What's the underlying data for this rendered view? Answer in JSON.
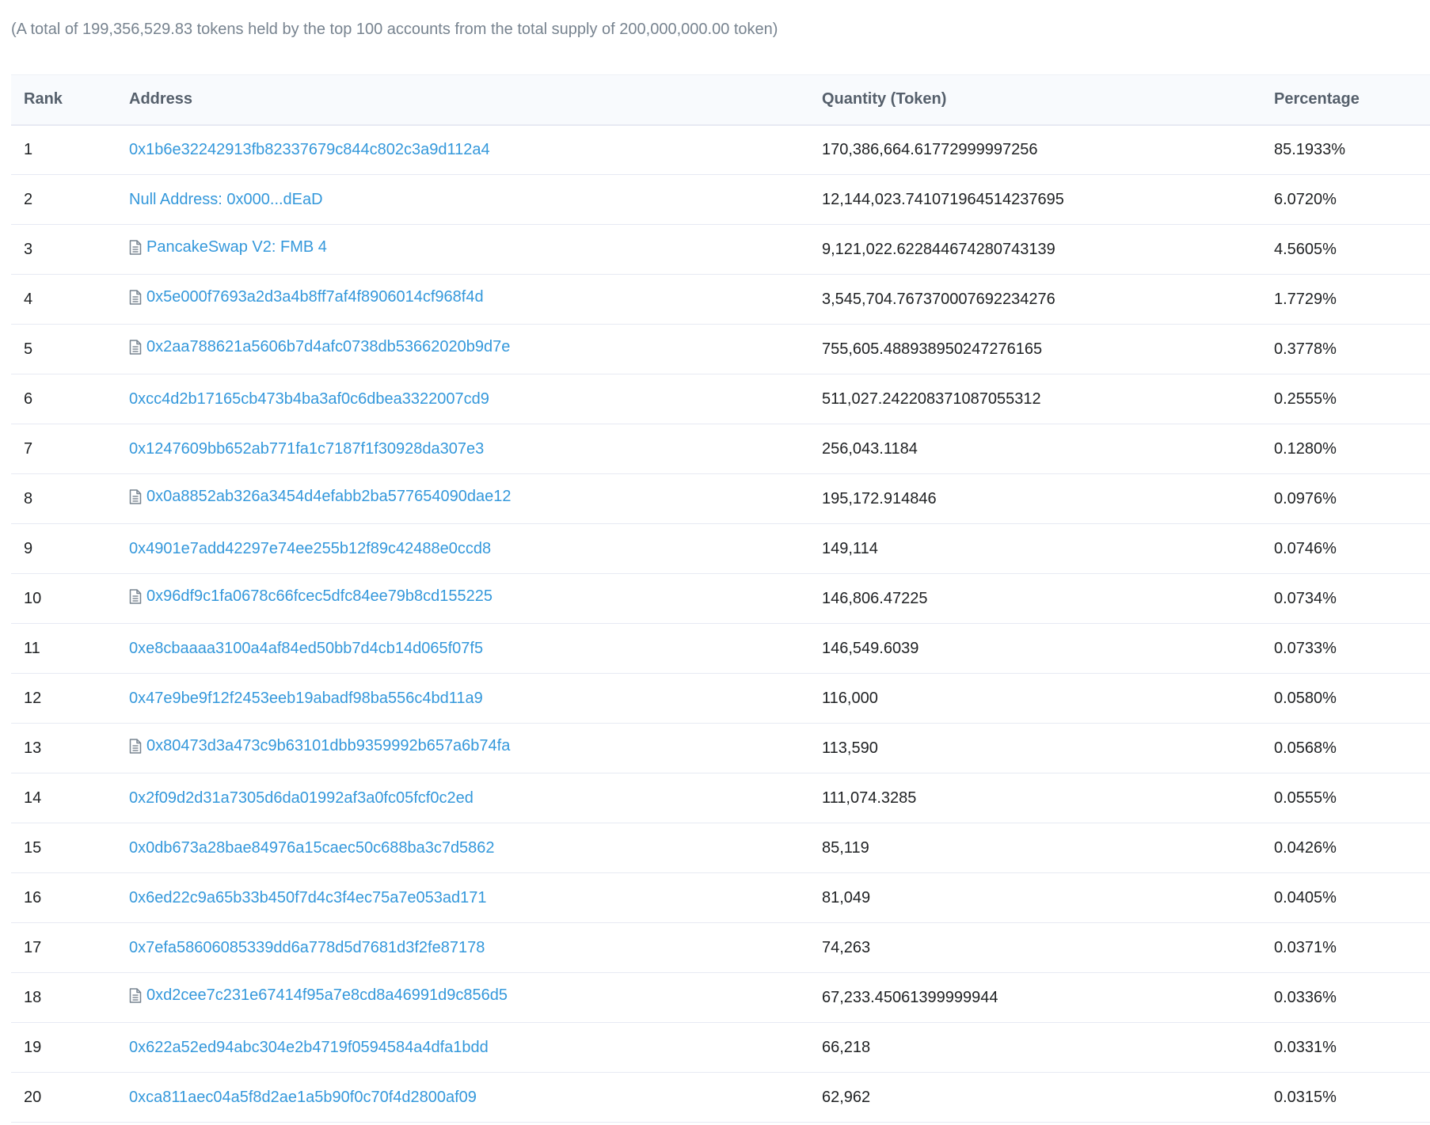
{
  "summary": "(A total of 199,356,529.83 tokens held by the top 100 accounts from the total supply of 200,000,000.00 token)",
  "table": {
    "headers": {
      "rank": "Rank",
      "address": "Address",
      "quantity": "Quantity (Token)",
      "percentage": "Percentage"
    },
    "rows": [
      {
        "rank": "1",
        "address": "0x1b6e32242913fb82337679c844c802c3a9d112a4",
        "contract": false,
        "quantity": "170,386,664.61772999997256",
        "percentage": "85.1933%"
      },
      {
        "rank": "2",
        "address": "Null Address: 0x000...dEaD",
        "contract": false,
        "quantity": "12,144,023.741071964514237695",
        "percentage": "6.0720%"
      },
      {
        "rank": "3",
        "address": "PancakeSwap V2: FMB 4",
        "contract": true,
        "quantity": "9,121,022.622844674280743139",
        "percentage": "4.5605%"
      },
      {
        "rank": "4",
        "address": "0x5e000f7693a2d3a4b8ff7af4f8906014cf968f4d",
        "contract": true,
        "quantity": "3,545,704.767370007692234276",
        "percentage": "1.7729%"
      },
      {
        "rank": "5",
        "address": "0x2aa788621a5606b7d4afc0738db53662020b9d7e",
        "contract": true,
        "quantity": "755,605.488938950247276165",
        "percentage": "0.3778%"
      },
      {
        "rank": "6",
        "address": "0xcc4d2b17165cb473b4ba3af0c6dbea3322007cd9",
        "contract": false,
        "quantity": "511,027.242208371087055312",
        "percentage": "0.2555%"
      },
      {
        "rank": "7",
        "address": "0x1247609bb652ab771fa1c7187f1f30928da307e3",
        "contract": false,
        "quantity": "256,043.1184",
        "percentage": "0.1280%"
      },
      {
        "rank": "8",
        "address": "0x0a8852ab326a3454d4efabb2ba577654090dae12",
        "contract": true,
        "quantity": "195,172.914846",
        "percentage": "0.0976%"
      },
      {
        "rank": "9",
        "address": "0x4901e7add42297e74ee255b12f89c42488e0ccd8",
        "contract": false,
        "quantity": "149,114",
        "percentage": "0.0746%"
      },
      {
        "rank": "10",
        "address": "0x96df9c1fa0678c66fcec5dfc84ee79b8cd155225",
        "contract": true,
        "quantity": "146,806.47225",
        "percentage": "0.0734%"
      },
      {
        "rank": "11",
        "address": "0xe8cbaaaa3100a4af84ed50bb7d4cb14d065f07f5",
        "contract": false,
        "quantity": "146,549.6039",
        "percentage": "0.0733%"
      },
      {
        "rank": "12",
        "address": "0x47e9be9f12f2453eeb19abadf98ba556c4bd11a9",
        "contract": false,
        "quantity": "116,000",
        "percentage": "0.0580%"
      },
      {
        "rank": "13",
        "address": "0x80473d3a473c9b63101dbb9359992b657a6b74fa",
        "contract": true,
        "quantity": "113,590",
        "percentage": "0.0568%"
      },
      {
        "rank": "14",
        "address": "0x2f09d2d31a7305d6da01992af3a0fc05fcf0c2ed",
        "contract": false,
        "quantity": "111,074.3285",
        "percentage": "0.0555%"
      },
      {
        "rank": "15",
        "address": "0x0db673a28bae84976a15caec50c688ba3c7d5862",
        "contract": false,
        "quantity": "85,119",
        "percentage": "0.0426%"
      },
      {
        "rank": "16",
        "address": "0x6ed22c9a65b33b450f7d4c3f4ec75a7e053ad171",
        "contract": false,
        "quantity": "81,049",
        "percentage": "0.0405%"
      },
      {
        "rank": "17",
        "address": "0x7efa58606085339dd6a778d5d7681d3f2fe87178",
        "contract": false,
        "quantity": "74,263",
        "percentage": "0.0371%"
      },
      {
        "rank": "18",
        "address": "0xd2cee7c231e67414f95a7e8cd8a46991d9c856d5",
        "contract": true,
        "quantity": "67,233.45061399999944",
        "percentage": "0.0336%"
      },
      {
        "rank": "19",
        "address": "0x622a52ed94abc304e2b4719f0594584a4dfa1bdd",
        "contract": false,
        "quantity": "66,218",
        "percentage": "0.0331%"
      },
      {
        "rank": "20",
        "address": "0xca811aec04a5f8d2ae1a5b90f0c70f4d2800af09",
        "contract": false,
        "quantity": "62,962",
        "percentage": "0.0315%"
      }
    ]
  },
  "icons": {
    "contract": "file-text-icon"
  },
  "colors": {
    "link": "#3498db",
    "muted_text": "#77838f",
    "header_bg": "#f8fafd",
    "row_border": "#e7eaf3"
  }
}
